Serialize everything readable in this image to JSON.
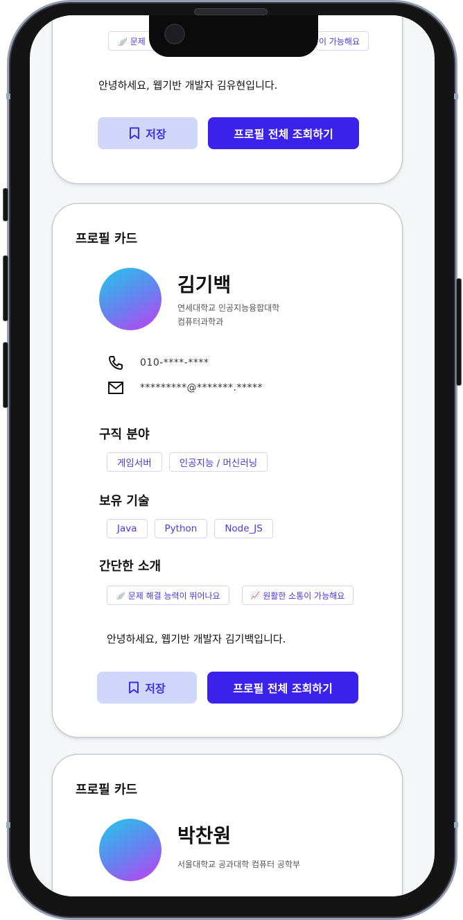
{
  "card_title": "프로필 카드",
  "top_card": {
    "tags_visible": [
      "🪽 문제",
      "소통이 가능해요"
    ],
    "intro": "안녕하세요, 웹기반 개발자 김유현입니다.",
    "save_label": "저장",
    "profile_label": "프로필 전체 조회하기"
  },
  "profile": {
    "name": "김기백",
    "school_line1": "연세대학교 인공지능융합대학",
    "school_line2": "컴퓨터과학과",
    "phone": "010-****-****",
    "email": "*********@*******.*****",
    "sections": {
      "jobs_title": "구직 분야",
      "skills_title": "보유 기술",
      "intro_title": "간단한 소개"
    },
    "jobs": [
      "게임서버",
      "인공지능 / 머신러닝"
    ],
    "skills": [
      "Java",
      "Python",
      "Node_JS"
    ],
    "intro_tags": [
      {
        "emoji": "🪽",
        "text": "문제 해결 능력이 뛰어나요"
      },
      {
        "emoji": "📈",
        "text": "원활한 소통이 가능해요"
      }
    ],
    "intro": "안녕하세요, 웹기반 개발자 김기백입니다.",
    "save_label": "저장",
    "profile_label": "프로필 전체 조회하기"
  },
  "next_profile": {
    "name": "박찬원",
    "school": "서울대학교 공과대학 컴퓨터 공학부"
  },
  "colors": {
    "accent": "#3b22ea",
    "save_bg": "#d0d7fb",
    "tag_text": "#4b35e0",
    "screen_bg": "#f5f6f8"
  }
}
